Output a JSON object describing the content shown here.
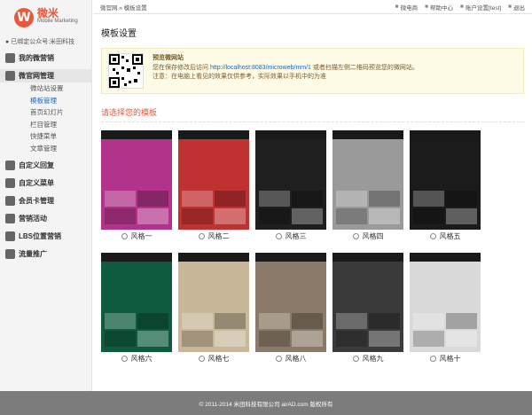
{
  "logo": {
    "mark": "W",
    "cn": "微米",
    "en": "Mobile Marketing"
  },
  "bound": "已绑定公众号:米田科技",
  "menu": [
    {
      "label": "我的微营销",
      "icon": "home-icon",
      "active": false,
      "subs": []
    },
    {
      "label": "微官网管理",
      "icon": "gear-icon",
      "active": true,
      "subs": [
        {
          "label": "微站站设置",
          "active": false
        },
        {
          "label": "模板管理",
          "active": true
        },
        {
          "label": "首页幻灯片",
          "active": false
        },
        {
          "label": "栏目管理",
          "active": false
        },
        {
          "label": "快捷菜单",
          "active": false
        },
        {
          "label": "文章管理",
          "active": false
        }
      ]
    },
    {
      "label": "自定义回复",
      "icon": "grid-icon",
      "active": false,
      "subs": []
    },
    {
      "label": "自定义菜单",
      "icon": "grid-icon",
      "active": false,
      "subs": []
    },
    {
      "label": "会员卡管理",
      "icon": "card-icon",
      "active": false,
      "subs": []
    },
    {
      "label": "营销活动",
      "icon": "gift-icon",
      "active": false,
      "subs": []
    },
    {
      "label": "LBS位置营销",
      "icon": "location-icon",
      "active": false,
      "subs": []
    },
    {
      "label": "流量推广",
      "icon": "megaphone-icon",
      "active": false,
      "subs": []
    }
  ],
  "breadcrumb": "微官网 » 模板设置",
  "topnav": [
    {
      "label": "微电商",
      "icon": "cart-icon"
    },
    {
      "label": "帮助中心",
      "icon": "help-icon"
    },
    {
      "label": "账户设置[test]",
      "icon": "settings-icon"
    },
    {
      "label": "退出",
      "icon": "logout-icon"
    }
  ],
  "page_title": "模板设置",
  "preview": {
    "title": "预览微网站",
    "line1_a": "您在保存修改后访问",
    "url": "http://localhost:8083/microweb/mm/1",
    "line1_b": "或者扫描左侧二维码预览您的微网站。",
    "line2": "注意：在电脑上看见的效果仅供参考，实际效果以手机中的为准"
  },
  "choose_title": "请选择您的模板",
  "templates": [
    {
      "label": "风格一",
      "color": "#b2348a"
    },
    {
      "label": "风格二",
      "color": "#c03131"
    },
    {
      "label": "风格三",
      "color": "#1f1f1f"
    },
    {
      "label": "风格四",
      "color": "#9a9a9a"
    },
    {
      "label": "风格五",
      "color": "#1b1b1b"
    },
    {
      "label": "风格六",
      "color": "#0f5b3f"
    },
    {
      "label": "风格七",
      "color": "#c9b79a"
    },
    {
      "label": "风格八",
      "color": "#8a7a69"
    },
    {
      "label": "风格九",
      "color": "#3a3a3a"
    },
    {
      "label": "风格十",
      "color": "#d9d9d9"
    }
  ],
  "footer": "© 2011-2014 米田科技有限公司 airAD.com 版权所有"
}
